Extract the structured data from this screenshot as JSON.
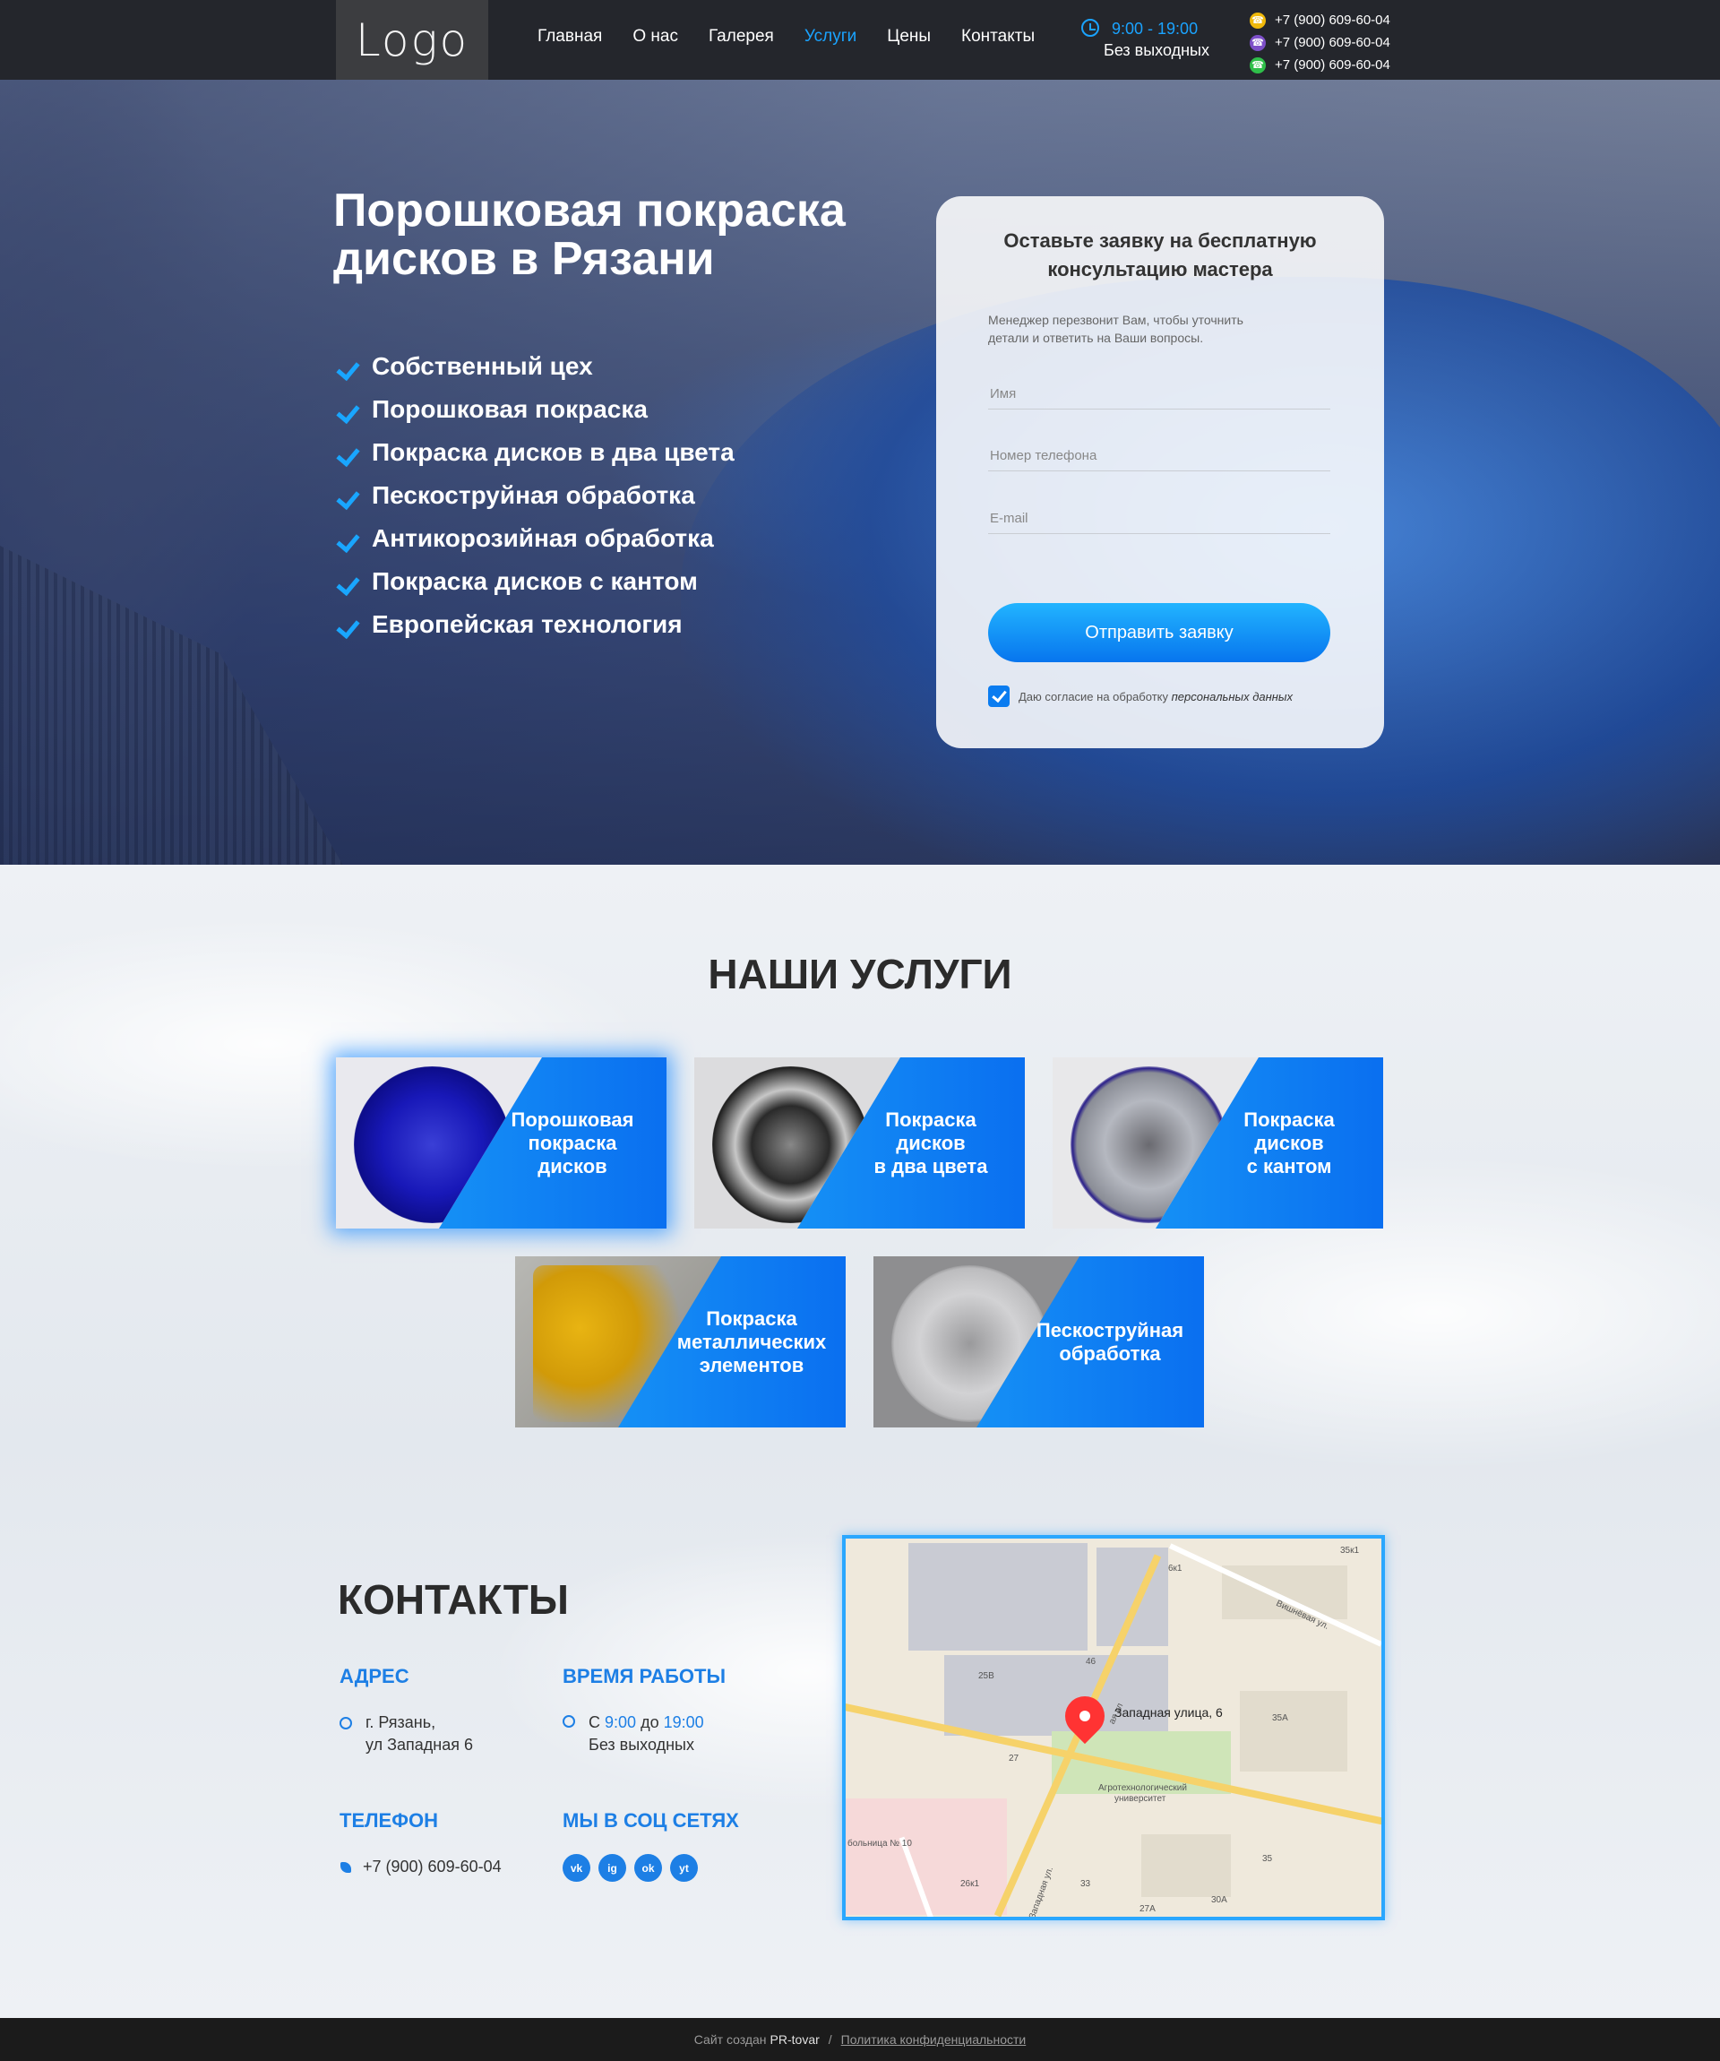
{
  "header": {
    "logo": "Logo",
    "nav": [
      "Главная",
      "О нас",
      "Галерея",
      "Услуги",
      "Цены",
      "Контакты"
    ],
    "active_nav": "Услуги",
    "hours": "9:00 - 19:00",
    "days": "Без выходных",
    "phones": [
      "+7 (900) 609-60-04",
      "+7 (900) 609-60-04",
      "+7 (900) 609-60-04"
    ],
    "phone_icons": [
      "phone-icon",
      "viber-icon",
      "whatsapp-icon"
    ]
  },
  "hero": {
    "title_line1": "Порошковая покраска",
    "title_line2": "дисков в Рязани",
    "features": [
      "Собственный цех",
      "Порошковая покраска",
      "Покраска дисков в два цвета",
      "Пескоструйная обработка",
      "Антикорозийная обработка",
      "Покраска дисков с кантом",
      "Европейская технология"
    ]
  },
  "form": {
    "title_line1": "Оставьте заявку на бесплатную",
    "title_line2": "консультацию мастера",
    "hint_line1": "Менеджер перезвонит Вам, чтобы уточнить",
    "hint_line2": "детали и ответить на Ваши вопросы.",
    "name_placeholder": "Имя",
    "phone_placeholder": "Номер телефона",
    "email_placeholder": "E-mail",
    "submit": "Отправить заявку",
    "consent_text": "Даю согласие на обработку",
    "consent_link": "персональных данных",
    "consent_checked": true
  },
  "services": {
    "title": "НАШИ УСЛУГИ",
    "items": [
      {
        "line1": "Порошковая",
        "line2": "покраска",
        "line3": "дисков"
      },
      {
        "line1": "Покраска",
        "line2": "дисков",
        "line3": "в два цвета"
      },
      {
        "line1": "Покраска",
        "line2": "дисков",
        "line3": "с кантом"
      },
      {
        "line1": "Покраска",
        "line2": "металлических",
        "line3": "элементов"
      },
      {
        "line1": "Пескоструйная",
        "line2": "обработка",
        "line3": ""
      }
    ]
  },
  "contacts": {
    "title": "КОНТАКТЫ",
    "address_head": "АДРЕС",
    "address_line1": "г. Рязань,",
    "address_line2": "ул Западная 6",
    "hours_head": "ВРЕМЯ РАБОТЫ",
    "hours_from_label": "С",
    "hours_from": "9:00",
    "hours_to_label": "до",
    "hours_to": "19:00",
    "hours_days": "Без выходных",
    "phone_head": "ТЕЛЕФОН",
    "phone": "+7 (900) 609-60-04",
    "social_head": "МЫ В СОЦ СЕТЯХ",
    "socials": [
      "vk-icon",
      "instagram-icon",
      "odnoklassniki-icon",
      "youtube-icon"
    ],
    "social_glyphs": [
      "vk",
      "ig",
      "ok",
      "yt"
    ]
  },
  "map": {
    "address": "Западная улица, 6",
    "labels": [
      "6к1",
      "35к1",
      "Вишнёвая ул.",
      "25В",
      "46",
      "35А",
      "27",
      "Агротехнологический",
      "университет",
      "больница № 10",
      "26к1",
      "33",
      "35",
      "27А",
      "30А",
      "Западная ул.",
      "ая ул"
    ]
  },
  "footer": {
    "created": "Сайт создан",
    "brand": "PR-tovar",
    "separator": "/",
    "policy": "Политика конфиденциальности"
  },
  "colors": {
    "accent": "#1aa3ff",
    "button_gradient_top": "#22b4ff",
    "button_gradient_bottom": "#0775ee",
    "header_bg": "#12141a",
    "footer_bg": "#1b1b1b"
  }
}
